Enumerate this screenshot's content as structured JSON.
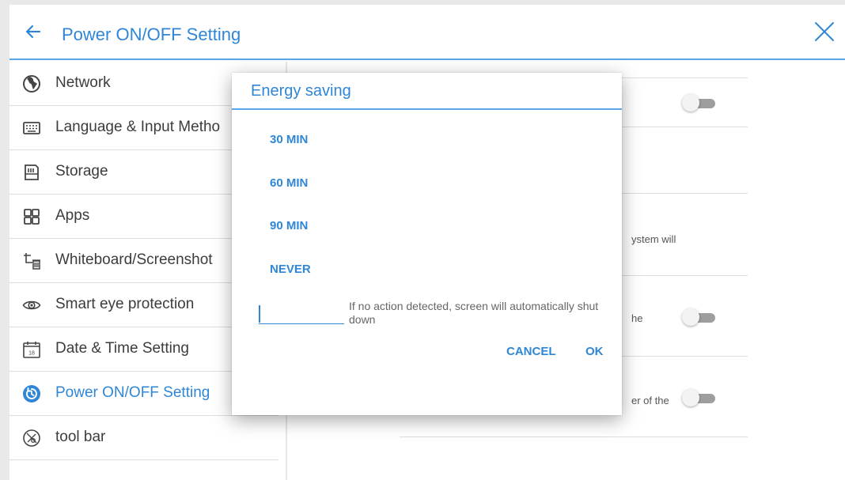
{
  "header": {
    "title": "Power ON/OFF Setting",
    "back_icon": "arrow-left-icon",
    "close_icon": "close-icon"
  },
  "sidebar": {
    "items": [
      {
        "label": "Network",
        "icon": "globe-icon"
      },
      {
        "label": "Language & Input Metho",
        "icon": "keyboard-icon"
      },
      {
        "label": "Storage",
        "icon": "sd-card-icon"
      },
      {
        "label": "Apps",
        "icon": "grid-icon"
      },
      {
        "label": "Whiteboard/Screenshot",
        "icon": "crop-trash-icon"
      },
      {
        "label": "Smart eye protection",
        "icon": "eye-icon"
      },
      {
        "label": "Date & Time Setting",
        "icon": "calendar-icon"
      },
      {
        "label": "Power ON/OFF Setting",
        "icon": "power-icon",
        "active": true
      },
      {
        "label": "tool bar",
        "icon": "toolbar-icon"
      }
    ],
    "calendar_day": "18"
  },
  "content": {
    "text_system_will": "ystem will",
    "text_he": "he",
    "text_er_of_the": "er of the",
    "toggles": [
      false,
      false,
      false
    ]
  },
  "dialog": {
    "title": "Energy saving",
    "options": [
      "30 MIN",
      "60 MIN",
      "90 MIN",
      "NEVER"
    ],
    "input_value": "",
    "hint": "If no action detected, screen will automatically shut down",
    "cancel_label": "CANCEL",
    "ok_label": "OK"
  },
  "colors": {
    "accent": "#2f86d6",
    "divider_accent": "#5aa4e8",
    "toggle_off_track": "#9e9e9e"
  }
}
